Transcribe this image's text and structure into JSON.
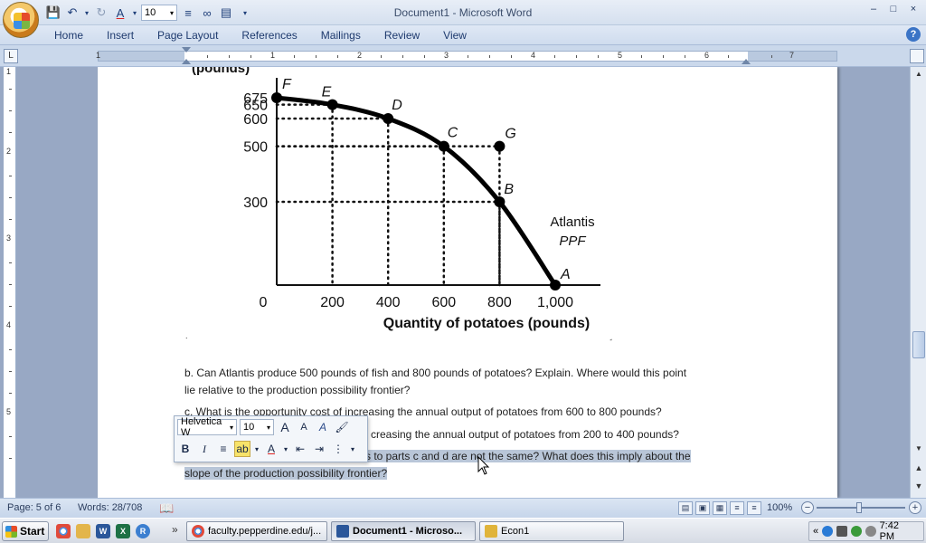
{
  "window": {
    "title": "Document1 - Microsoft Word",
    "controls": [
      "–",
      "□",
      "×"
    ]
  },
  "quick_access": {
    "font_size": "10"
  },
  "ribbon": {
    "tabs": [
      "Home",
      "Insert",
      "Page Layout",
      "References",
      "Mailings",
      "Review",
      "View"
    ],
    "help": "?"
  },
  "ruler": {
    "numbers": [
      "1",
      "1",
      "2",
      "3",
      "4",
      "5",
      "6",
      "7"
    ],
    "tab_selector": "L"
  },
  "vruler": {
    "numbers": [
      "1",
      "2",
      "3",
      "4",
      "5"
    ]
  },
  "figure": {
    "ylabel_fragment": "(pounds)",
    "y_ticks": [
      "675",
      "650",
      "600",
      "500",
      "300"
    ],
    "x_ticks": [
      "0",
      "200",
      "400",
      "600",
      "800",
      "1,000"
    ],
    "xlabel": "Quantity of potatoes (pounds)",
    "curve_label_line1": "Atlantis",
    "curve_label_line2": "PPF",
    "point_labels": [
      "F",
      "E",
      "D",
      "C",
      "G",
      "B",
      "A"
    ]
  },
  "document": {
    "para_b_line1": "b. Can Atlantis produce  500 pounds of fish and 800 pounds of potatoes? Explain. Where would this point",
    "para_b_line2": "lie relative to the production possibility frontier?",
    "para_c": "c. What is the opportunity cost of increasing the annual output of potatoes from 600 to 800 pounds?",
    "para_d_tail": "creasing the annual output of potatoes from 200 to 400 pounds?",
    "para_e_tail": "s to parts c and d are not the same? What does this imply about the",
    "para_e_line2": "slope of the production possibility frontier?"
  },
  "mini_toolbar": {
    "font": "Helvetica W",
    "size": "10",
    "grow": "A",
    "shrink": "A",
    "styles": "A",
    "bold": "B",
    "italic": "I",
    "font_color": "A"
  },
  "status": {
    "page": "Page: 5 of 6",
    "words": "Words: 28/708",
    "zoom": "100%"
  },
  "taskbar": {
    "start": "Start",
    "windows": [
      {
        "label": "faculty.pepperdine.edu/j...",
        "color": "#d9492e"
      },
      {
        "label": "Document1 - Microso...",
        "color": "#2b579a"
      },
      {
        "label": "Econ1",
        "color": "#e0b43a"
      }
    ],
    "clock": "7:42 PM"
  },
  "chart_data": {
    "type": "line",
    "title": "",
    "xlabel": "Quantity of potatoes (pounds)",
    "ylabel": "(pounds)",
    "x_ticks": [
      0,
      200,
      400,
      600,
      800,
      1000
    ],
    "y_ticks": [
      300,
      500,
      600,
      650,
      675
    ],
    "xlim": [
      0,
      1000
    ],
    "ylim": [
      0,
      675
    ],
    "series": [
      {
        "name": "Atlantis PPF",
        "points": [
          {
            "label": "F",
            "x": 0,
            "y": 675
          },
          {
            "label": "E",
            "x": 200,
            "y": 650
          },
          {
            "label": "D",
            "x": 400,
            "y": 600
          },
          {
            "label": "C",
            "x": 600,
            "y": 500
          },
          {
            "label": "B",
            "x": 800,
            "y": 300
          },
          {
            "label": "A",
            "x": 1000,
            "y": 0
          }
        ]
      }
    ],
    "extra_points": [
      {
        "label": "G",
        "x": 800,
        "y": 500
      }
    ],
    "grid": "dotted guide lines to each point"
  }
}
